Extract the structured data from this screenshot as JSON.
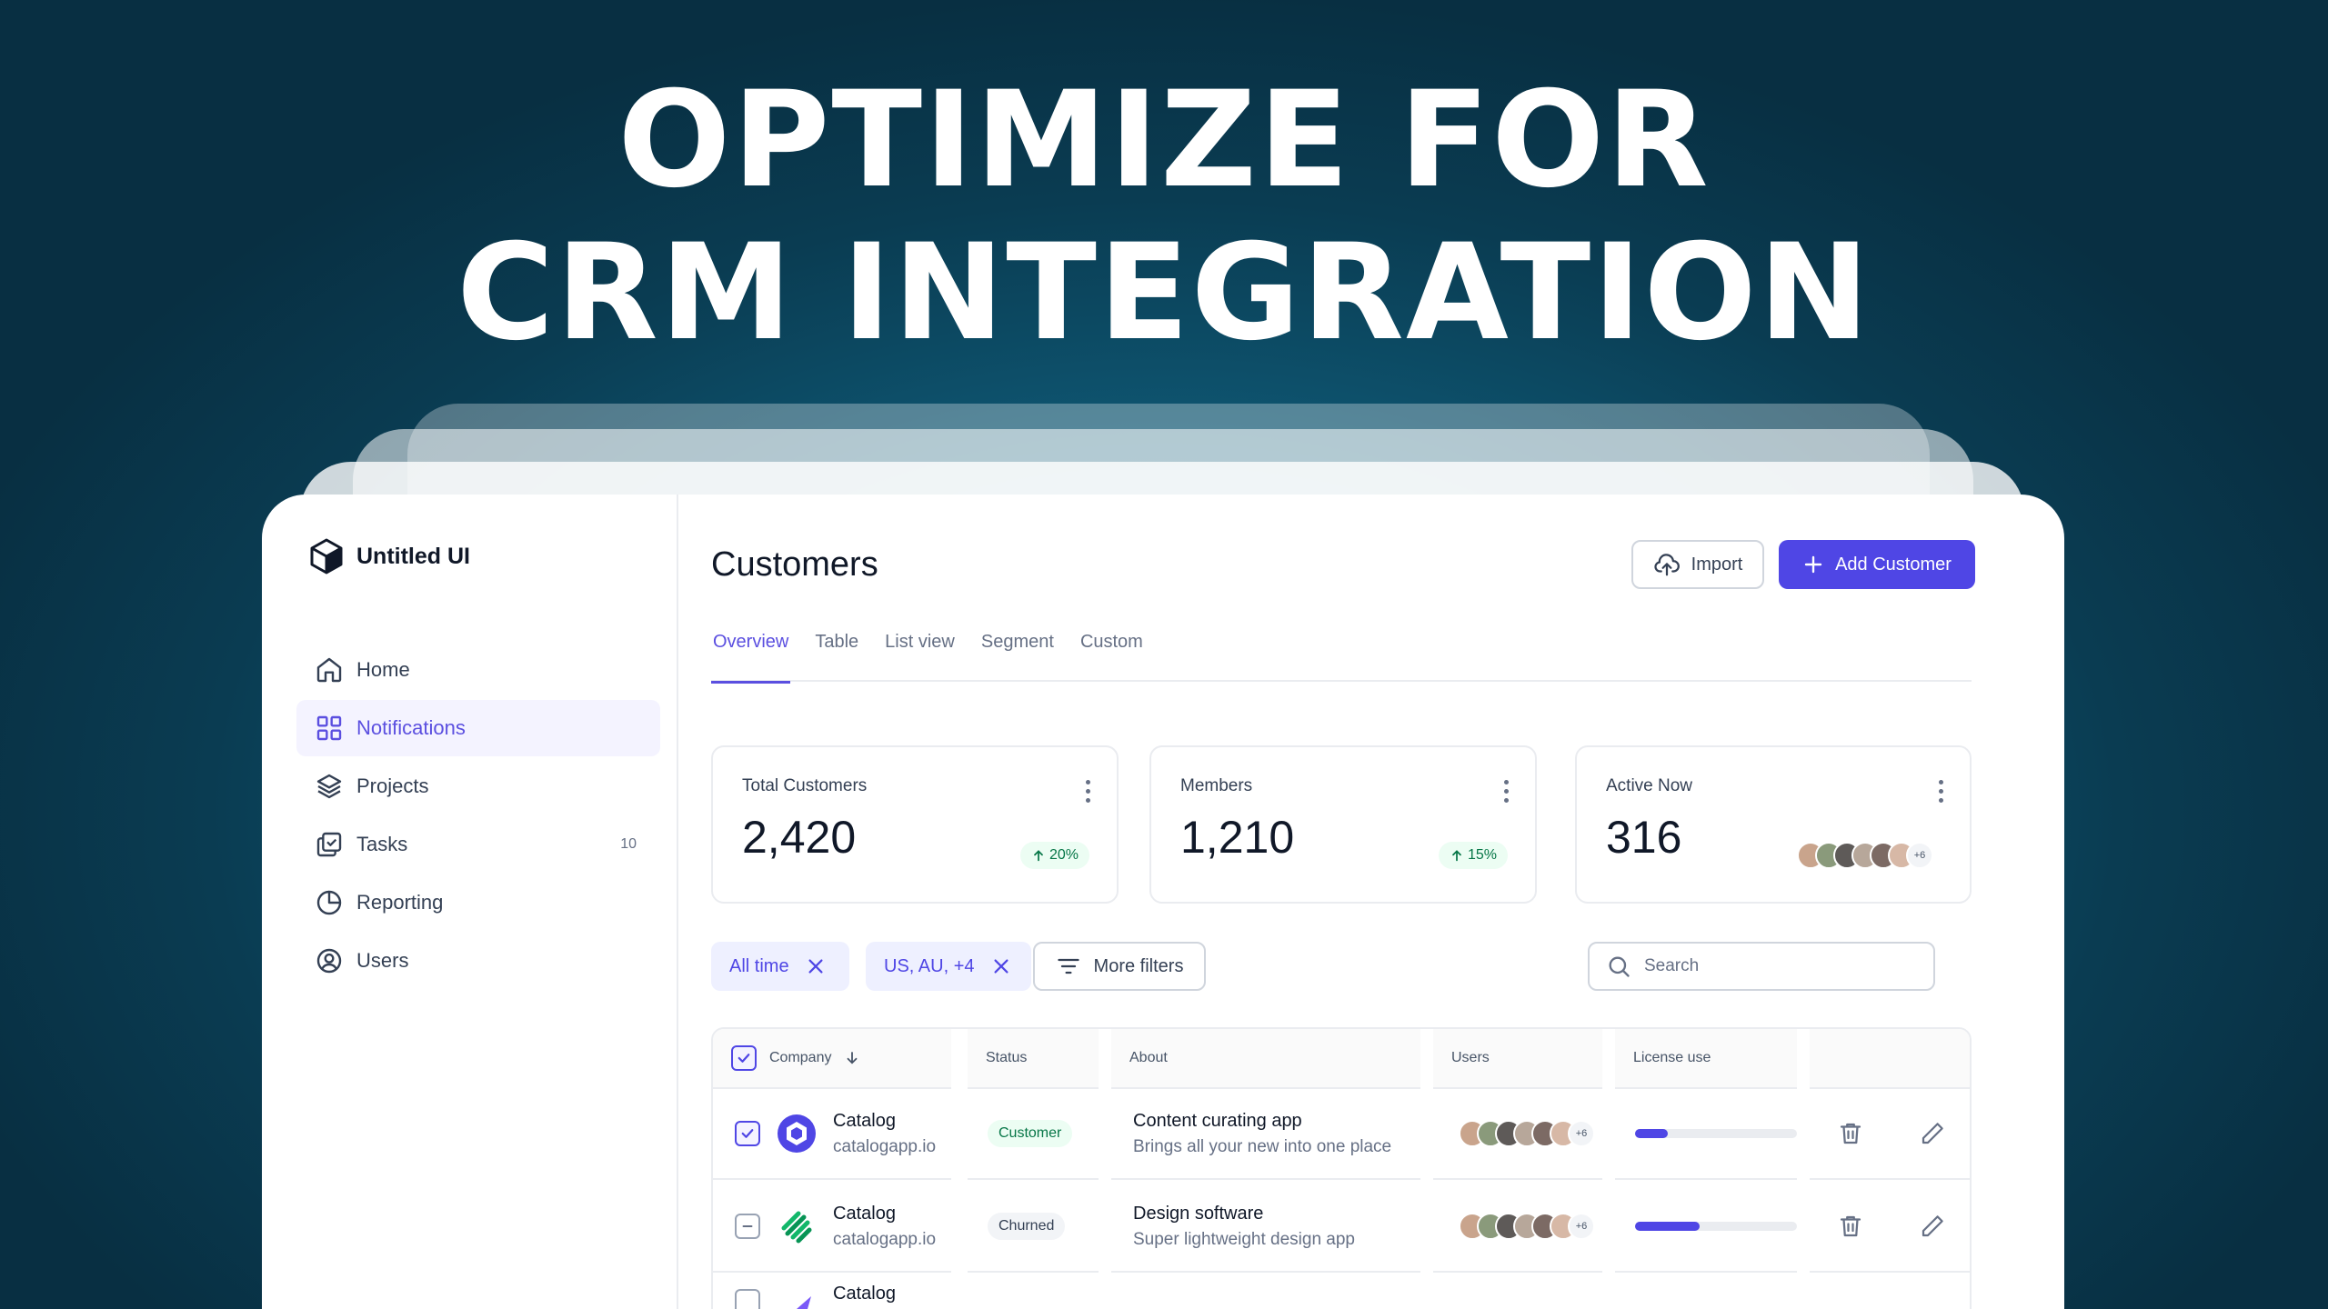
{
  "headline": {
    "line1": "OPTIMIZE FOR",
    "line2": "CRM INTEGRATION"
  },
  "app": {
    "name": "Untitled UI"
  },
  "sidebar": {
    "items": [
      {
        "label": "Home",
        "icon": "home-icon"
      },
      {
        "label": "Notifications",
        "icon": "grid-icon",
        "active": true
      },
      {
        "label": "Projects",
        "icon": "layers-icon"
      },
      {
        "label": "Tasks",
        "icon": "check-square-icon",
        "badge": "10"
      },
      {
        "label": "Reporting",
        "icon": "pie-chart-icon"
      },
      {
        "label": "Users",
        "icon": "user-circle-icon"
      }
    ]
  },
  "header": {
    "title": "Customers",
    "import_label": "Import",
    "add_label": "Add Customer"
  },
  "tabs": [
    {
      "label": "Overview",
      "active": true
    },
    {
      "label": "Table"
    },
    {
      "label": "List view"
    },
    {
      "label": "Segment"
    },
    {
      "label": "Custom"
    }
  ],
  "stats": [
    {
      "label": "Total Customers",
      "value": "2,420",
      "delta": "20%"
    },
    {
      "label": "Members",
      "value": "1,210",
      "delta": "15%"
    },
    {
      "label": "Active Now",
      "value": "316",
      "avatars_more": "+6"
    }
  ],
  "filters": {
    "chips": [
      "All time",
      "US, AU, +4"
    ],
    "more_label": "More filters",
    "search_placeholder": "Search"
  },
  "table": {
    "headers": {
      "company": "Company",
      "status": "Status",
      "about": "About",
      "users": "Users",
      "license": "License use"
    },
    "rows": [
      {
        "company": "Catalog",
        "url": "catalogapp.io",
        "status": "Customer",
        "about_title": "Content curating app",
        "about_sub": "Brings all your new into one place",
        "users_more": "+6",
        "license_use": 0.2,
        "checked": true
      },
      {
        "company": "Catalog",
        "url": "catalogapp.io",
        "status": "Churned",
        "about_title": "Design software",
        "about_sub": "Super lightweight design app",
        "users_more": "+6",
        "license_use": 0.4,
        "checked": false
      },
      {
        "company": "Catalog"
      }
    ]
  },
  "colors": {
    "accent": "#4f46e5",
    "success": "#067647",
    "background": "#0f5b78"
  }
}
